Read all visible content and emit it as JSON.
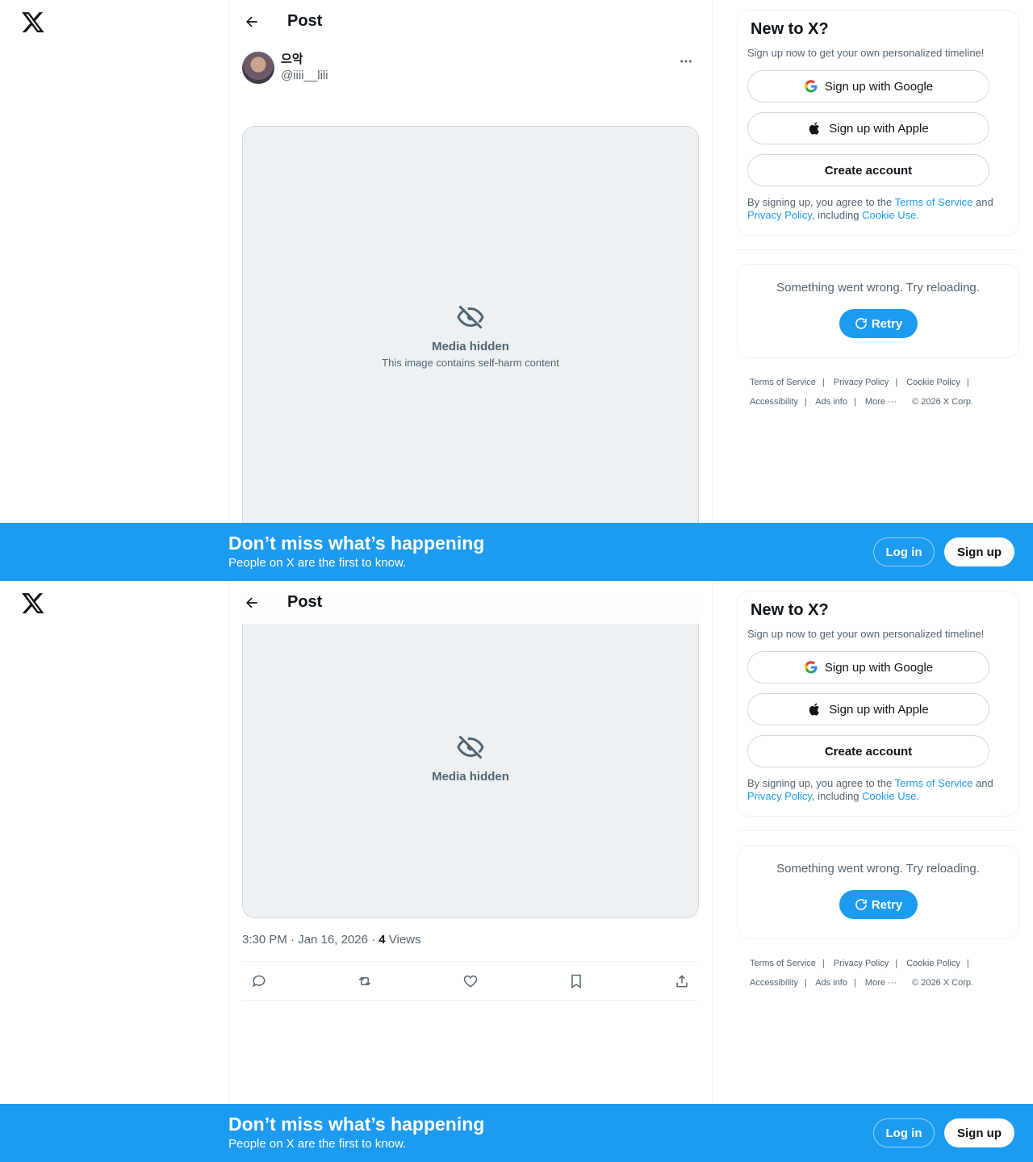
{
  "header": {
    "title": "Post"
  },
  "post": {
    "display_name": "으악",
    "handle": "@iiii__lili",
    "media_notice": "Media hidden",
    "media_notice_sub": "This image contains self-harm content",
    "time": "3:30 PM · Jan 16, 2026 · ",
    "views_count": "4",
    "views_label": " Views"
  },
  "sidebar": {
    "title": "New to X?",
    "subtitle": "Sign up now to get your own personalized timeline!",
    "google_label": "Sign up with Google",
    "apple_label": "Sign up with Apple",
    "create_label": "Create account",
    "terms_pre": "By signing up, you agree to the ",
    "terms_link": "Terms of Service",
    "terms_and": " and ",
    "privacy_link": "Privacy Policy",
    "terms_including": ", including ",
    "cookie_link": "Cookie Use.",
    "error_text": "Something went wrong. Try reloading.",
    "retry_label": "Retry"
  },
  "footer": {
    "links": [
      "Terms of Service",
      "Privacy Policy",
      "Cookie Policy",
      "Accessibility",
      "Ads info",
      "More ···"
    ],
    "copyright": "© 2026 X Corp."
  },
  "banner": {
    "title": "Don’t miss what’s happening",
    "subtitle": "People on X are the first to know.",
    "login_label": "Log in",
    "signup_label": "Sign up"
  },
  "colors": {
    "accent": "#1d9bf0",
    "text": "#0f1419",
    "muted": "#536471",
    "border": "#eff3f4"
  }
}
